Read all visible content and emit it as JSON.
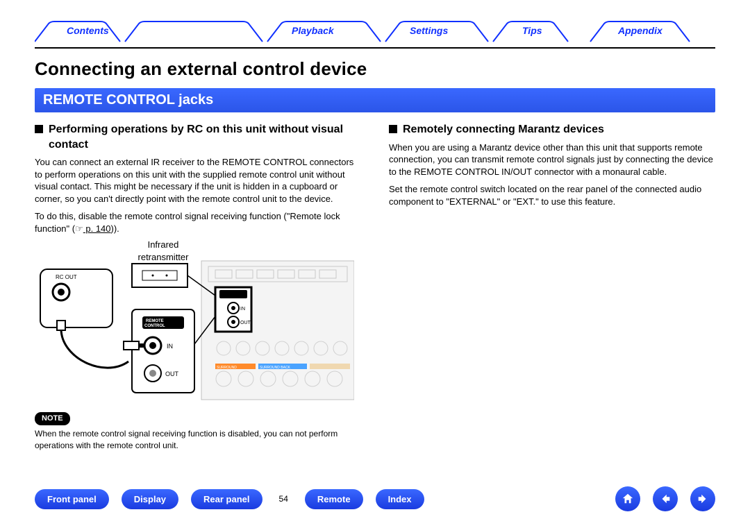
{
  "topnav": {
    "contents": "Contents",
    "playback": "Playback",
    "settings": "Settings",
    "tips": "Tips",
    "appendix": "Appendix"
  },
  "heading": "Connecting an external control device",
  "section_title": "REMOTE CONTROL jacks",
  "left": {
    "subtitle": "Performing operations by RC on this unit without visual contact",
    "p1": "You can connect an external IR receiver to the REMOTE CONTROL connectors to perform operations on this unit with the supplied remote control unit without visual contact. This might be necessary if the unit is hidden in a cupboard or corner, so you can't directly point with the remote control unit to the device.",
    "p2a": "To do this, disable the remote control signal receiving function (\"Remote lock function\" (☞",
    "p2_link": " p. 140",
    "p2b": ")).",
    "diagram_label": "Infrared retransmitter",
    "diag_rcout": "RC OUT",
    "diag_rc_box": "REMOTE CONTROL",
    "diag_in": "IN",
    "diag_out": "OUT",
    "note_badge": "NOTE",
    "note_text": "When the remote control signal receiving function is disabled, you can not perform operations with the remote control unit."
  },
  "right": {
    "subtitle": "Remotely connecting Marantz devices",
    "p1": "When you are using a Marantz device other than this unit that supports remote connection, you can transmit remote control signals just by connecting the device to the REMOTE CONTROL IN/OUT connector with a monaural cable.",
    "p2": "Set the remote control switch located on the rear panel of the connected audio component to \"EXTERNAL\" or \"EXT.\" to use this feature."
  },
  "bottom": {
    "front_panel": "Front panel",
    "display": "Display",
    "rear_panel": "Rear panel",
    "page_num": "54",
    "remote": "Remote",
    "index": "Index"
  }
}
